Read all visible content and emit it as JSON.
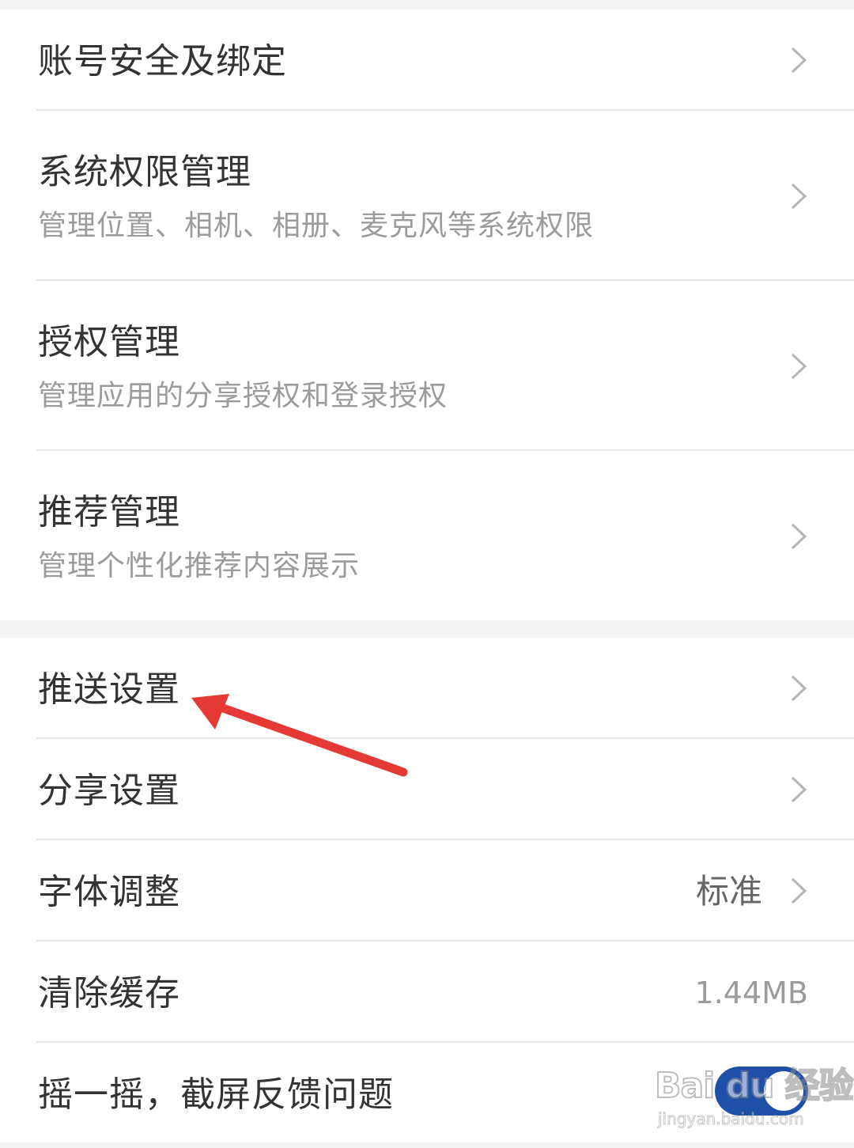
{
  "settings_group_1": [
    {
      "title": "账号安全及绑定"
    },
    {
      "title": "系统权限管理",
      "subtitle": "管理位置、相机、相册、麦克风等系统权限"
    },
    {
      "title": "授权管理",
      "subtitle": "管理应用的分享授权和登录授权"
    },
    {
      "title": "推荐管理",
      "subtitle": "管理个性化推荐内容展示"
    }
  ],
  "settings_group_2": [
    {
      "title": "推送设置"
    },
    {
      "title": "分享设置"
    },
    {
      "title": "字体调整",
      "value": "标准"
    },
    {
      "title": "清除缓存",
      "value": "1.44MB"
    },
    {
      "title": "摇一摇，截屏反馈问题",
      "toggle_on": true
    }
  ],
  "watermark": {
    "brand": "Bai du 经验",
    "url": "jingyan.baidu.com"
  },
  "colors": {
    "toggle_on": "#1f50a8",
    "annotation_arrow": "#e53935"
  },
  "icons": {
    "row_chevron": "chevron-right-icon"
  }
}
